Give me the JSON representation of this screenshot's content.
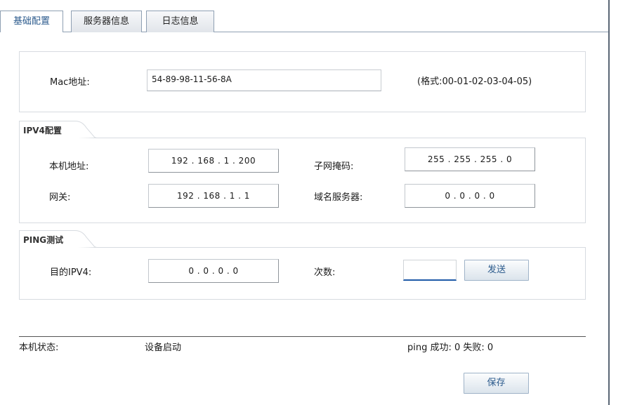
{
  "tabs": [
    {
      "label": "基础配置",
      "active": true
    },
    {
      "label": "服务器信息",
      "active": false
    },
    {
      "label": "日志信息",
      "active": false
    }
  ],
  "mac": {
    "label": "Mac地址:",
    "value": "54-89-98-11-56-8A",
    "format_hint": "(格式:00-01-02-03-04-05)"
  },
  "ipv4": {
    "section_title": "IPV4配置",
    "local_ip": {
      "label": "本机地址:",
      "value": "192 . 168 . 1 . 200"
    },
    "subnet_mask": {
      "label": "子网掩码:",
      "value": "255 . 255 . 255 . 0"
    },
    "gateway": {
      "label": "网关:",
      "value": "192 . 168 . 1 . 1"
    },
    "dns": {
      "label": "域名服务器:",
      "value": "0 . 0 . 0 . 0"
    }
  },
  "ping": {
    "section_title": "PING测试",
    "target": {
      "label": "目的IPV4:",
      "value": "0 . 0 . 0 . 0"
    },
    "count": {
      "label": "次数:",
      "value": ""
    },
    "send_label": "发送"
  },
  "status": {
    "label": "本机状态:",
    "value": "设备启动",
    "ping_result": "ping 成功: 0 失败: 0"
  },
  "save_label": "保存",
  "colors": {
    "accent_text": "#2b5a8c",
    "tab_border": "#8fa0b3",
    "input_focus_border": "#1e5aa8"
  }
}
